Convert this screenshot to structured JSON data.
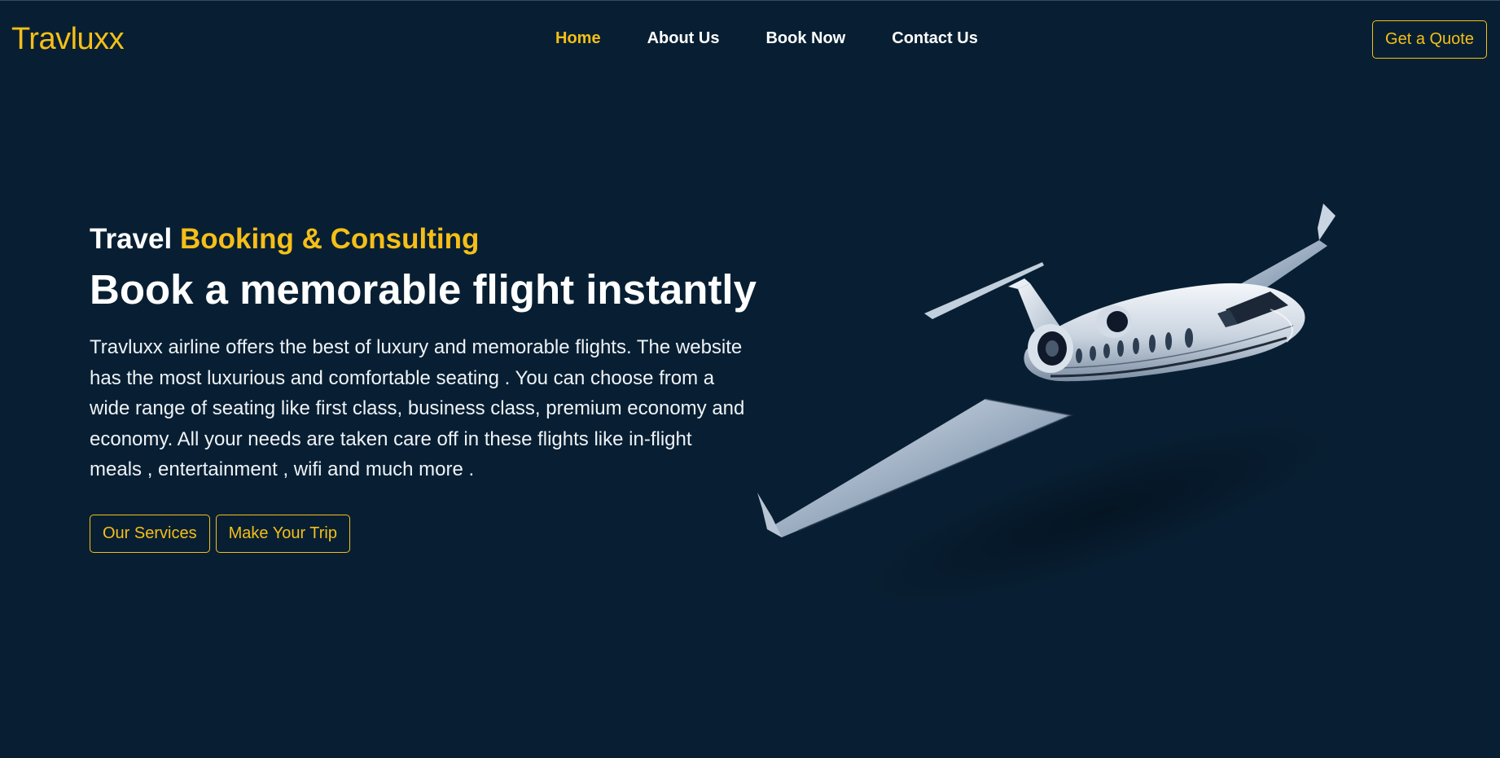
{
  "brand": {
    "logo": "Travluxx",
    "accent_color": "#f5bf18",
    "background_color": "#081f33"
  },
  "nav": {
    "items": [
      {
        "label": "Home",
        "active": true
      },
      {
        "label": "About Us",
        "active": false
      },
      {
        "label": "Book Now",
        "active": false
      },
      {
        "label": "Contact Us",
        "active": false
      }
    ]
  },
  "header": {
    "quote_button": "Get a Quote"
  },
  "hero": {
    "eyebrow_prefix": "Travel",
    "eyebrow_accent": "Booking & Consulting",
    "headline": "Book a memorable flight instantly",
    "description": "Travluxx airline offers the best of luxury and memorable flights. The website has the most luxurious and comfortable seating . You can choose from a wide range of seating like first class, business class, premium economy and economy. All your needs are taken care off in these flights like in-flight meals , entertainment , wifi and much more .",
    "buttons": {
      "services": "Our Services",
      "trip": "Make Your Trip"
    },
    "image": "private-jet-illustration"
  }
}
